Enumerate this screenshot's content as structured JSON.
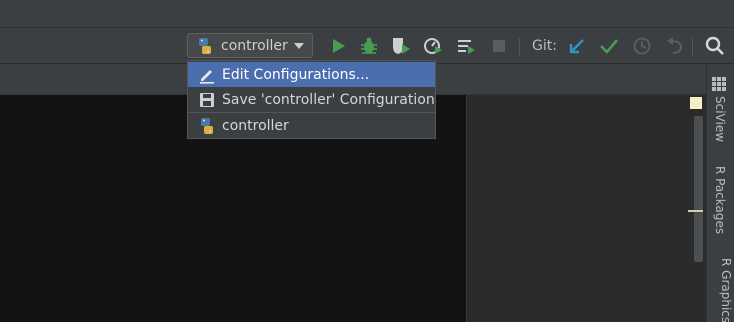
{
  "toolbar": {
    "run_config": "controller",
    "git_label": "Git:"
  },
  "dropdown": {
    "items": [
      {
        "label": "Edit Configurations...",
        "icon": "edit-icon",
        "selected": true
      },
      {
        "label": "Save 'controller' Configuration",
        "icon": "save-icon",
        "selected": false
      },
      {
        "label": "controller",
        "icon": "python-icon",
        "selected": false
      }
    ]
  },
  "sidebar": {
    "tabs": [
      {
        "label": "SciView",
        "icon": "grid-icon"
      },
      {
        "label": "R Packages"
      },
      {
        "label": "R Graphics"
      }
    ]
  },
  "colors": {
    "run": "#499c54",
    "debug": "#499c54",
    "git_update": "#3592c4",
    "git_commit": "#499c54",
    "selection": "#4b6eaf"
  }
}
